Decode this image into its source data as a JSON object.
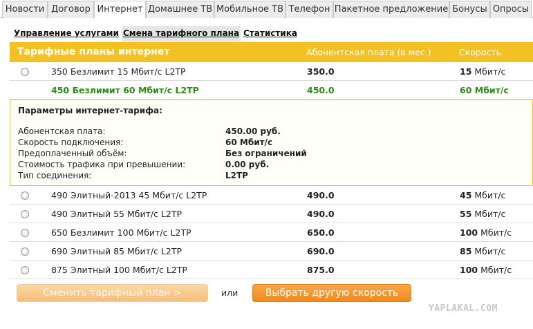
{
  "top_tabs": [
    {
      "label": "Новости"
    },
    {
      "label": "Договор"
    },
    {
      "label": "Интернет",
      "active": true
    },
    {
      "label": "Домашнее ТВ"
    },
    {
      "label": "Мобильное ТВ"
    },
    {
      "label": "Телефон"
    },
    {
      "label": "Пакетное предложение"
    },
    {
      "label": "Бонусы"
    },
    {
      "label": "Опросы"
    }
  ],
  "sub_tabs": [
    {
      "label": "Управление услугами"
    },
    {
      "label": "Смена тарифного плана",
      "active": true
    },
    {
      "label": "Статистика"
    }
  ],
  "table": {
    "title": "Тарифные планы интернет",
    "col_fee": "Абонентская плата (в мес.)",
    "col_speed": "Скорость",
    "speed_unit": "Мбит/с",
    "rows": [
      {
        "name": "350 Безлимит 15 Мбит/с L2TP",
        "fee": "350.0",
        "speed": "15"
      },
      {
        "name": "450 Безлимит 60 Мбит/с L2TP",
        "fee": "450.0",
        "speed": "60",
        "selected": true
      },
      {
        "name": "490 Элитный-2013 45 Мбит/с L2TP",
        "fee": "490.0",
        "speed": "45"
      },
      {
        "name": "490 Элитный 55 Мбит/с L2TP",
        "fee": "490.0",
        "speed": "55"
      },
      {
        "name": "650 Безлимит 100 Мбит/с L2TP",
        "fee": "650.0",
        "speed": "100"
      },
      {
        "name": "690 Элитный 85 Мбит/с L2TP",
        "fee": "690.0",
        "speed": "85"
      },
      {
        "name": "875 Элитный 100 Мбит/с L2TP",
        "fee": "875.0",
        "speed": "100"
      }
    ]
  },
  "params": {
    "title": "Параметры интернет-тарифа:",
    "items": [
      {
        "label": "Абонентская плата:",
        "value": "450.00 руб."
      },
      {
        "label": "Скорость подключения:",
        "value": "60 Мбит/с"
      },
      {
        "label": "Предоплаченный объём:",
        "value": "Без ограничений"
      },
      {
        "label": "Стоимость трафика при превышении:",
        "value": "0.00 руб."
      },
      {
        "label": "Тип соединения:",
        "value": "L2TP"
      }
    ]
  },
  "actions": {
    "change_plan": "Сменить тарифный план >",
    "or": "или",
    "choose_speed": "Выбрать другую скорость"
  },
  "watermark": "YAPLAKAL.COM",
  "colors": {
    "accent": "#f4c125",
    "selected_text": "#2e8a17",
    "primary_button": "#ef8a1c"
  }
}
